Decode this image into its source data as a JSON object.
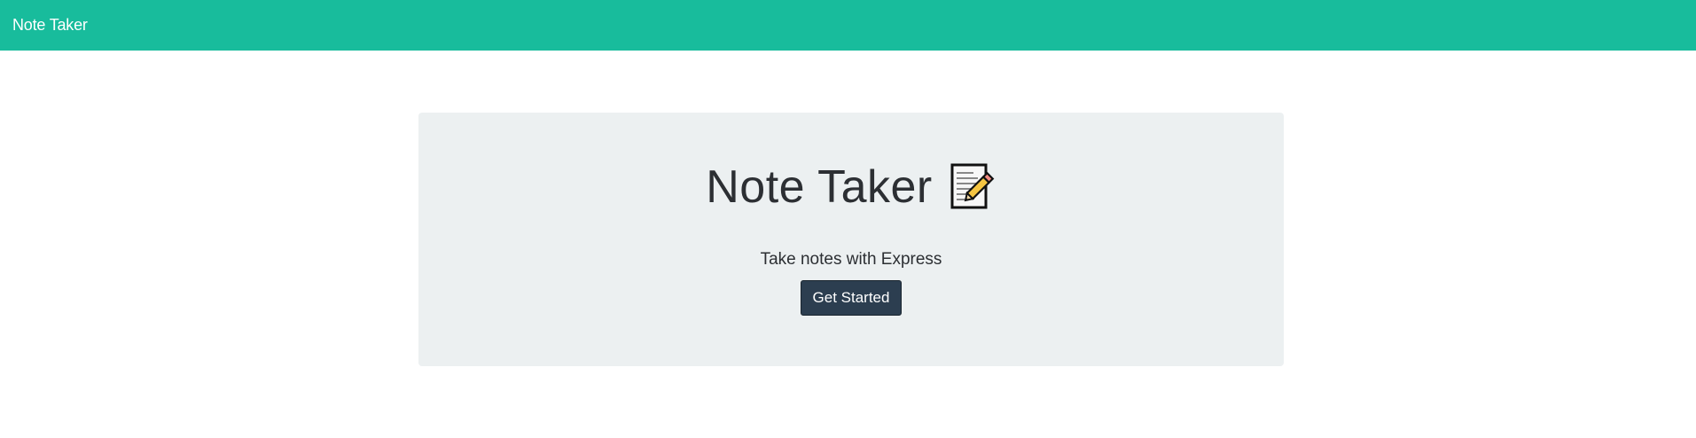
{
  "navbar": {
    "brand": "Note Taker",
    "color": "#18bc9c"
  },
  "hero": {
    "title": "Note Taker",
    "icon": "memo-icon",
    "subtitle": "Take notes with Express",
    "button_label": "Get Started",
    "panel_color": "#ecf0f1",
    "button_color": "#2c3e50"
  }
}
